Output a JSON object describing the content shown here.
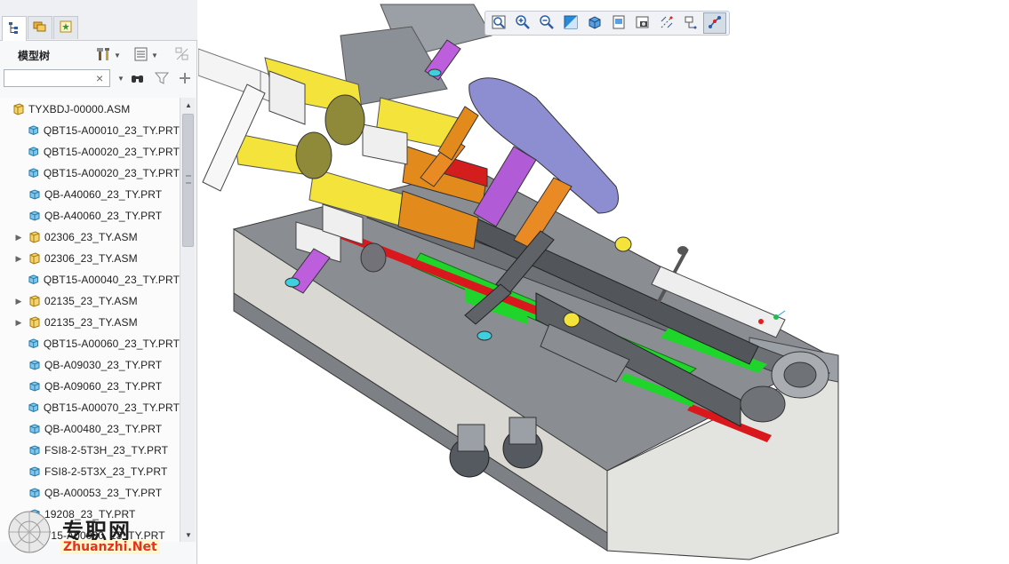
{
  "panel": {
    "tabs": [
      {
        "icon": "model-tree-icon",
        "active": true
      },
      {
        "icon": "folder-browser-icon",
        "active": false
      },
      {
        "icon": "favorites-icon",
        "active": false
      }
    ],
    "title": "模型树",
    "header_icons": [
      "settings-icon",
      "show-icon",
      "filter-visibility-icon"
    ],
    "search": {
      "value": "",
      "clear": "×"
    },
    "search_icons": [
      "find-icon",
      "filter-icon",
      "add-icon"
    ]
  },
  "tree": {
    "root": "TYXBDJ-00000.ASM",
    "items": [
      {
        "label": "QBT15-A00010_23_TY.PRT",
        "type": "part"
      },
      {
        "label": "QBT15-A00020_23_TY.PRT",
        "type": "part"
      },
      {
        "label": "QBT15-A00020_23_TY.PRT",
        "type": "part"
      },
      {
        "label": "QB-A40060_23_TY.PRT",
        "type": "part"
      },
      {
        "label": "QB-A40060_23_TY.PRT",
        "type": "part"
      },
      {
        "label": "02306_23_TY.ASM",
        "type": "assembly"
      },
      {
        "label": "02306_23_TY.ASM",
        "type": "assembly"
      },
      {
        "label": "QBT15-A00040_23_TY.PRT",
        "type": "part"
      },
      {
        "label": "02135_23_TY.ASM",
        "type": "assembly"
      },
      {
        "label": "02135_23_TY.ASM",
        "type": "assembly"
      },
      {
        "label": "QBT15-A00060_23_TY.PRT",
        "type": "part"
      },
      {
        "label": "QB-A09030_23_TY.PRT",
        "type": "part"
      },
      {
        "label": "QB-A09060_23_TY.PRT",
        "type": "part"
      },
      {
        "label": "QBT15-A00070_23_TY.PRT",
        "type": "part"
      },
      {
        "label": "QB-A00480_23_TY.PRT",
        "type": "part"
      },
      {
        "label": "FSI8-2-5T3H_23_TY.PRT",
        "type": "part"
      },
      {
        "label": "FSI8-2-5T3X_23_TY.PRT",
        "type": "part"
      },
      {
        "label": "QB-A00053_23_TY.PRT",
        "type": "part"
      },
      {
        "label": "19208_23_TY.PRT",
        "type": "part"
      },
      {
        "label": "T15-A00030_23_TY.PRT",
        "type": "part"
      }
    ]
  },
  "toolbar": {
    "tools": [
      "refit-icon",
      "zoom-in-icon",
      "zoom-out-icon",
      "repaint-icon",
      "display-style-icon",
      "saved-views-icon",
      "view-manager-icon",
      "datum-display-icon",
      "spin-center-icon",
      "annotation-display-icon"
    ],
    "active_tool": "annotation-display-icon"
  },
  "watermark": {
    "cn": "专职网",
    "en": "Zhuanzhi.Net"
  },
  "colors": {
    "accent": "#3d7fd6",
    "yellow": "#f2e23a",
    "orange": "#e38a1d",
    "purple": "#b25bd6",
    "green": "#22d42a",
    "red": "#d9161c",
    "gray": "#8f9499"
  }
}
